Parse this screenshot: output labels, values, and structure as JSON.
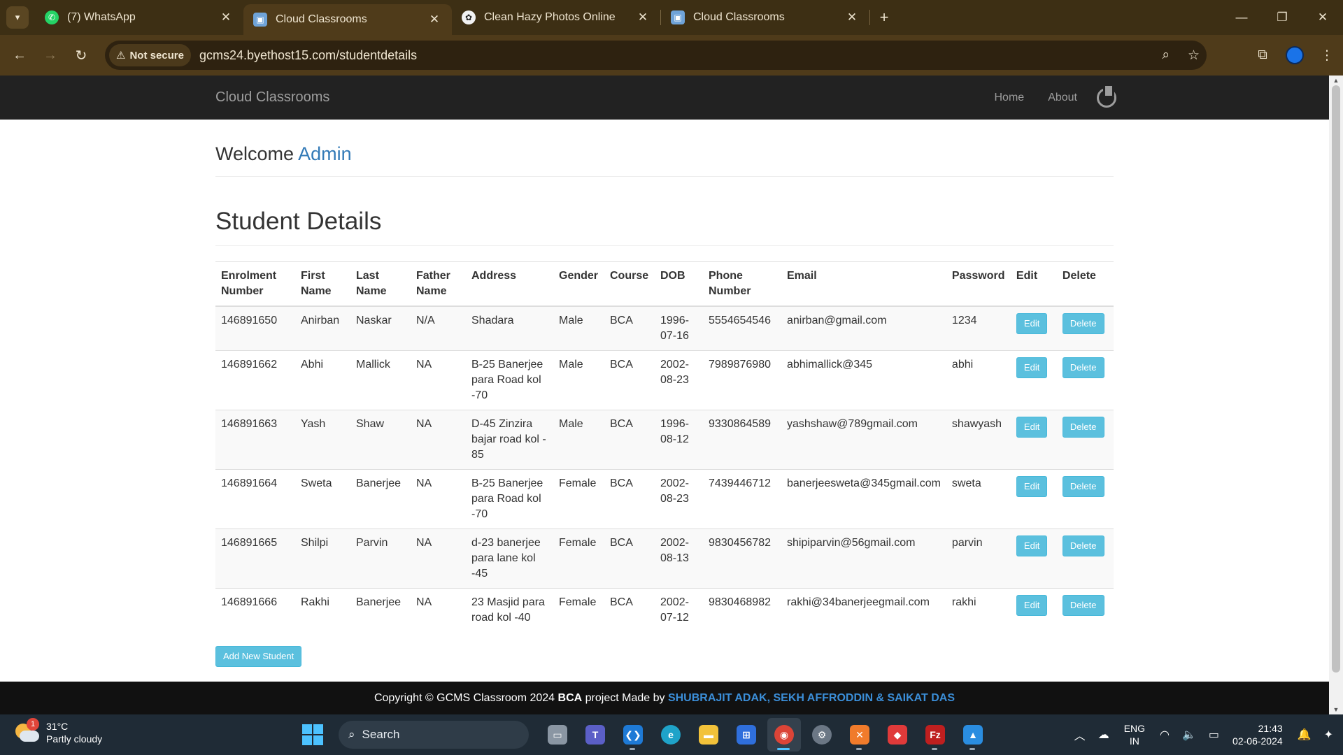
{
  "browser": {
    "tabs": [
      {
        "title": "(7) WhatsApp",
        "icon": "whatsapp-icon",
        "active": false
      },
      {
        "title": "Cloud Classrooms",
        "icon": "cloud-classrooms-icon",
        "active": true
      },
      {
        "title": "Clean Hazy Photos Online",
        "icon": "chatgpt-icon",
        "active": false
      },
      {
        "title": "Cloud Classrooms",
        "icon": "cloud-classrooms-icon",
        "active": false
      }
    ],
    "security_label": "Not secure",
    "url": "gcms24.byethost15.com/studentdetails"
  },
  "site": {
    "brand": "Cloud Classrooms",
    "nav": {
      "home": "Home",
      "about": "About"
    }
  },
  "welcome": {
    "prefix": "Welcome",
    "user": "Admin"
  },
  "heading": "Student Details",
  "table": {
    "headers": {
      "enrolment": [
        "Enrolment",
        "Number"
      ],
      "first": [
        "First",
        "Name"
      ],
      "last": [
        "Last",
        "Name"
      ],
      "father": [
        "Father",
        "Name"
      ],
      "address": "Address",
      "gender": "Gender",
      "course": "Course",
      "dob": "DOB",
      "phone": [
        "Phone",
        "Number"
      ],
      "email": "Email",
      "password": "Password",
      "edit": "Edit",
      "delete": "Delete"
    },
    "rows": [
      {
        "enrolment": "146891650",
        "first": "Anirban",
        "last": "Naskar",
        "father": "N/A",
        "address": [
          "Shadara"
        ],
        "gender": "Male",
        "course": "BCA",
        "dob": [
          "1996-",
          "07-16"
        ],
        "phone": "5554654546",
        "email": "anirban@gmail.com",
        "password": "1234"
      },
      {
        "enrolment": "146891662",
        "first": "Abhi",
        "last": "Mallick",
        "father": "NA",
        "address": [
          "B-25 Banerjee",
          "para Road kol",
          "-70"
        ],
        "gender": "Male",
        "course": "BCA",
        "dob": [
          "2002-",
          "08-23"
        ],
        "phone": "7989876980",
        "email": "abhimallick@345",
        "password": "abhi"
      },
      {
        "enrolment": "146891663",
        "first": "Yash",
        "last": "Shaw",
        "father": "NA",
        "address": [
          "D-45 Zinzira",
          "bajar road kol -",
          "85"
        ],
        "gender": "Male",
        "course": "BCA",
        "dob": [
          "1996-",
          "08-12"
        ],
        "phone": "9330864589",
        "email": "yashshaw@789gmail.com",
        "password": "shawyash"
      },
      {
        "enrolment": "146891664",
        "first": "Sweta",
        "last": "Banerjee",
        "father": "NA",
        "address": [
          "B-25 Banerjee",
          "para Road kol",
          "-70"
        ],
        "gender": "Female",
        "course": "BCA",
        "dob": [
          "2002-",
          "08-23"
        ],
        "phone": "7439446712",
        "email": "banerjeesweta@345gmail.com",
        "password": "sweta"
      },
      {
        "enrolment": "146891665",
        "first": "Shilpi",
        "last": "Parvin",
        "father": "NA",
        "address": [
          "d-23 banerjee",
          "para lane kol",
          "-45"
        ],
        "gender": "Female",
        "course": "BCA",
        "dob": [
          "2002-",
          "08-13"
        ],
        "phone": "9830456782",
        "email": "shipiparvin@56gmail.com",
        "password": "parvin"
      },
      {
        "enrolment": "146891666",
        "first": "Rakhi",
        "last": "Banerjee",
        "father": "NA",
        "address": [
          "23 Masjid para",
          "road kol -40"
        ],
        "gender": "Female",
        "course": "BCA",
        "dob": [
          "2002-",
          "07-12"
        ],
        "phone": "9830468982",
        "email": "rakhi@34banerjeegmail.com",
        "password": "rakhi"
      }
    ],
    "edit_label": "Edit",
    "delete_label": "Delete"
  },
  "add_button": "Add New Student",
  "footer": {
    "prefix": "Copyright © GCMS Classroom 2024",
    "project": "BCA",
    "middle": "project Made by",
    "authors": "SHUBRAJIT ADAK, SEKH AFFRODDIN & SAIKAT DAS"
  },
  "taskbar": {
    "weather": {
      "temp": "31°C",
      "desc": "Partly cloudy",
      "badge": "1"
    },
    "search_label": "Search",
    "lang": [
      "ENG",
      "IN"
    ],
    "time": "21:43",
    "date": "02-06-2024"
  },
  "colors": {
    "link": "#337ab7",
    "info_button": "#5bc0de",
    "navbar": "#222222",
    "footer_authors": "#3b8ed8"
  }
}
